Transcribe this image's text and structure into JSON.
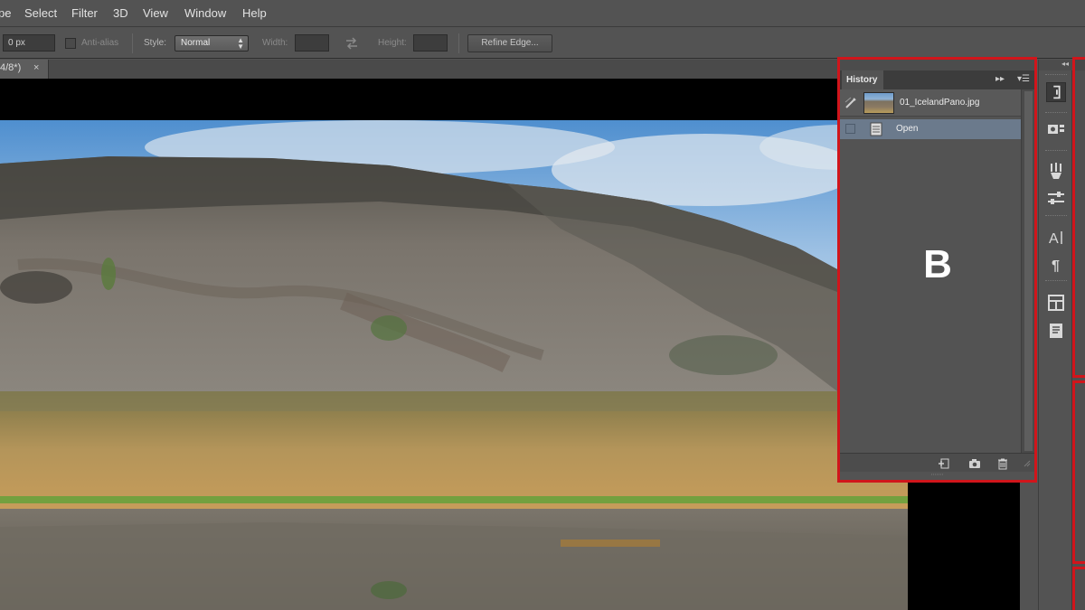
{
  "menu": [
    "pe",
    "Select",
    "Filter",
    "3D",
    "View",
    "Window",
    "Help"
  ],
  "options": {
    "feather_value": "0 px",
    "antialias_label": "Anti-alias",
    "style_label": "Style:",
    "style_value": "Normal",
    "width_label": "Width:",
    "height_label": "Height:",
    "refine_edge_label": "Refine Edge..."
  },
  "document_tab": {
    "title_fragment": "4/8*)",
    "close_glyph": "×"
  },
  "history_panel": {
    "tab_label": "History",
    "expand_glyph": "▸▸",
    "menu_glyph": "▾☰",
    "snapshot_label": "01_IcelandPano.jpg",
    "states": [
      {
        "label": "Open"
      }
    ],
    "annotation_letter": "B"
  },
  "colors": {
    "annotation": "#d1151b",
    "ui_background": "#535353",
    "selected_state": "#6b7a8c"
  },
  "icons": {
    "strip": [
      "history-icon",
      "properties-icon",
      "brush-presets-icon",
      "adjustments-icon",
      "character-icon",
      "paragraph-icon",
      "layout-icon",
      "notes-icon"
    ],
    "history_footer": [
      "new-document-from-state-icon",
      "camera-snapshot-icon",
      "trash-icon"
    ]
  }
}
